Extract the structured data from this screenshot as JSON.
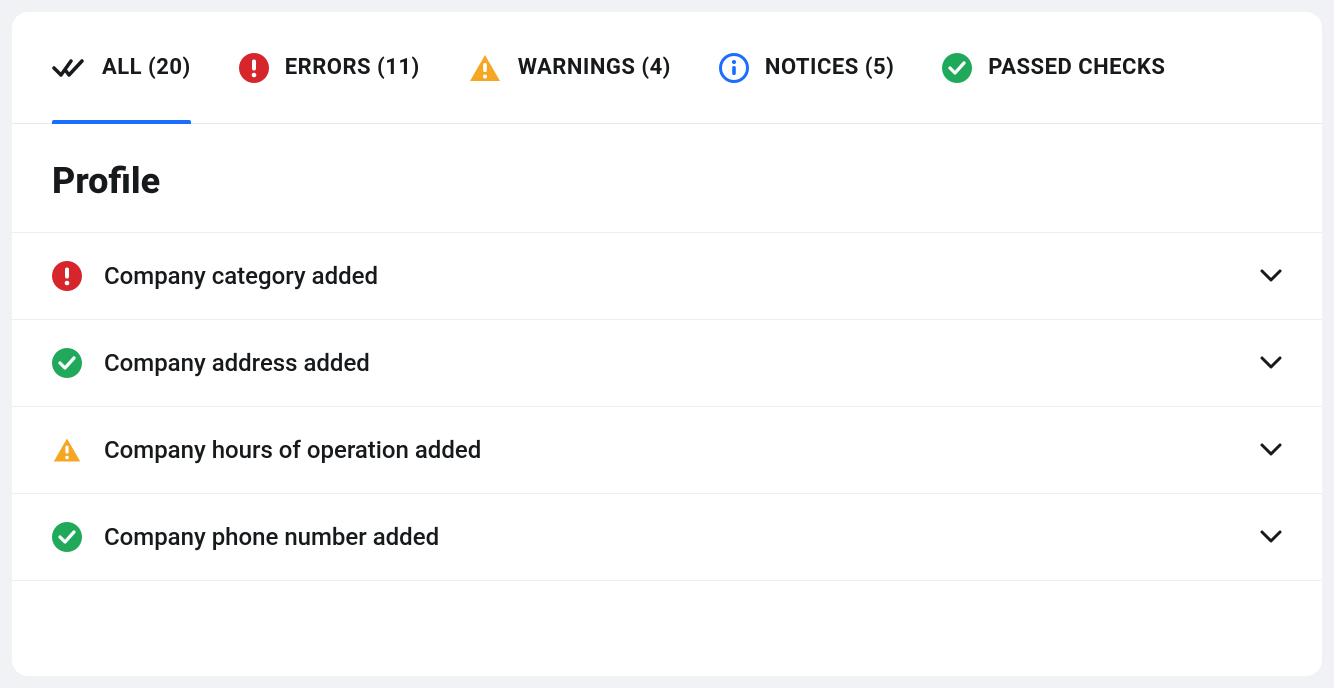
{
  "tabs": {
    "all": {
      "label": "ALL (20)"
    },
    "errors": {
      "label": "ERRORS (11)"
    },
    "warnings": {
      "label": "WARNINGS (4)"
    },
    "notices": {
      "label": "NOTICES (5)"
    },
    "passed": {
      "label": "PASSED CHECKS"
    }
  },
  "section": {
    "title": "Profile"
  },
  "checks": [
    {
      "status": "error",
      "label": "Company category added"
    },
    {
      "status": "passed",
      "label": "Company address added"
    },
    {
      "status": "warning",
      "label": "Company hours of operation added"
    },
    {
      "status": "passed",
      "label": "Company phone number added"
    }
  ],
  "colors": {
    "error": "#d7252c",
    "passed": "#21a95b",
    "warning": "#f5a623",
    "notice": "#1a6dff"
  }
}
